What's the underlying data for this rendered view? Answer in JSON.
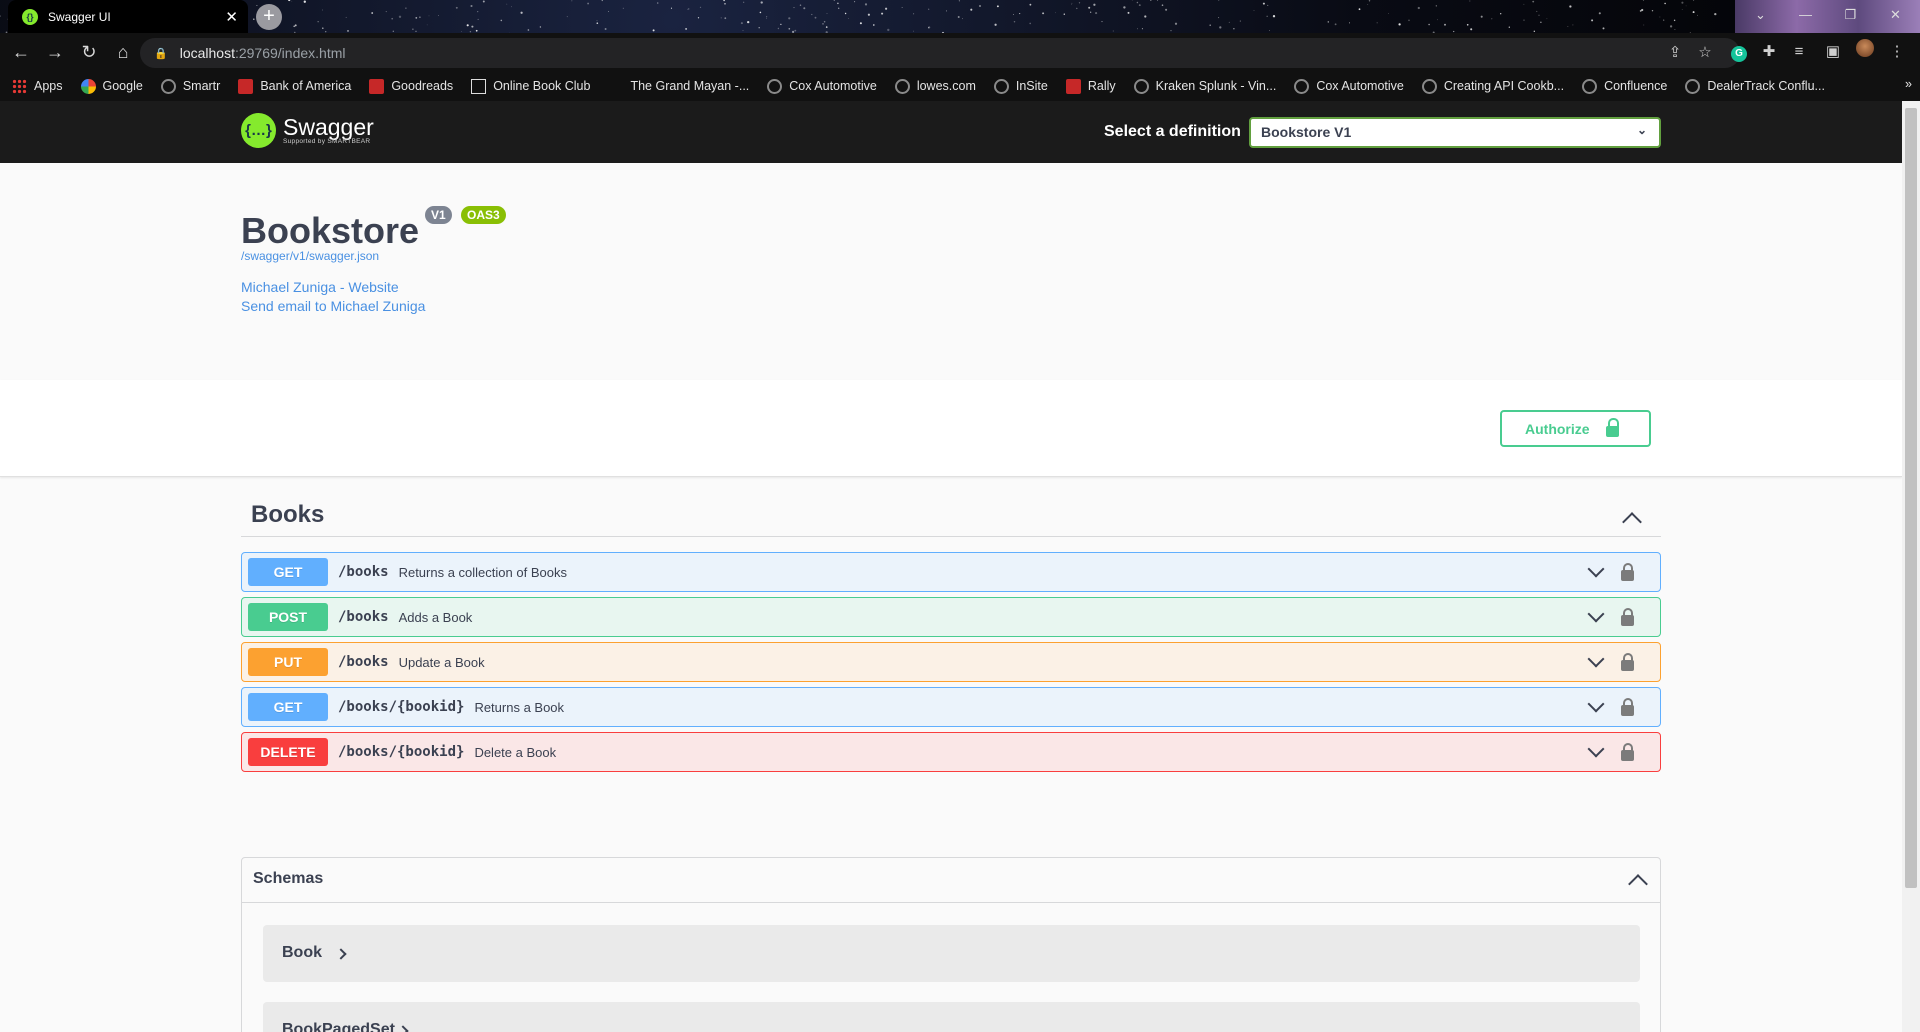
{
  "browser": {
    "tab_title": "Swagger UI",
    "tab_close": "✕",
    "new_tab": "+",
    "url_host": "localhost",
    "url_path": ":29769/index.html",
    "bookmarks": [
      {
        "label": "Apps",
        "icon": "apps-grid-icon"
      },
      {
        "label": "Google",
        "icon": "google-icon"
      },
      {
        "label": "Smartr",
        "icon": "globe-icon"
      },
      {
        "label": "Bank of America",
        "icon": "bank-of-america-icon"
      },
      {
        "label": "Goodreads",
        "icon": "goodreads-icon"
      },
      {
        "label": "Online Book Club",
        "icon": "book-club-icon"
      },
      {
        "label": "The Grand Mayan -...",
        "icon": "blank-icon"
      },
      {
        "label": "Cox Automotive",
        "icon": "globe-icon"
      },
      {
        "label": "lowes.com",
        "icon": "globe-icon"
      },
      {
        "label": "InSite",
        "icon": "globe-icon"
      },
      {
        "label": "Rally",
        "icon": "rally-icon"
      },
      {
        "label": "Kraken Splunk - Vin...",
        "icon": "globe-icon"
      },
      {
        "label": "Cox Automotive",
        "icon": "globe-icon"
      },
      {
        "label": "Creating API Cookb...",
        "icon": "globe-icon"
      },
      {
        "label": "Confluence",
        "icon": "globe-icon"
      },
      {
        "label": "DealerTrack Conflu...",
        "icon": "globe-icon"
      }
    ],
    "bookmarks_overflow": "»"
  },
  "topbar": {
    "brand": "Swagger",
    "brand_sub": "Supported by SMARTBEAR",
    "logo_glyph": "{…}",
    "select_label": "Select a definition",
    "selected_definition": "Bookstore V1"
  },
  "info": {
    "title": "Bookstore",
    "version_badge": "V1",
    "oas_badge": "OAS3",
    "spec_url": "/swagger/v1/swagger.json",
    "contact_website": "Michael Zuniga - Website",
    "contact_email": "Send email to Michael Zuniga"
  },
  "auth": {
    "label": "Authorize"
  },
  "tag": {
    "name": "Books"
  },
  "operations": [
    {
      "method": "GET",
      "path": "/books",
      "summary": "Returns a collection of Books",
      "color": "#61affe"
    },
    {
      "method": "POST",
      "path": "/books",
      "summary": "Adds a Book",
      "color": "#49cc90"
    },
    {
      "method": "PUT",
      "path": "/books",
      "summary": "Update a Book",
      "color": "#fca130"
    },
    {
      "method": "GET",
      "path": "/books/{bookid}",
      "summary": "Returns a Book",
      "color": "#61affe"
    },
    {
      "method": "DELETE",
      "path": "/books/{bookid}",
      "summary": "Delete a Book",
      "color": "#f93e3e"
    }
  ],
  "schemas": {
    "title": "Schemas",
    "models": [
      "Book",
      "BookPagedSet"
    ]
  }
}
